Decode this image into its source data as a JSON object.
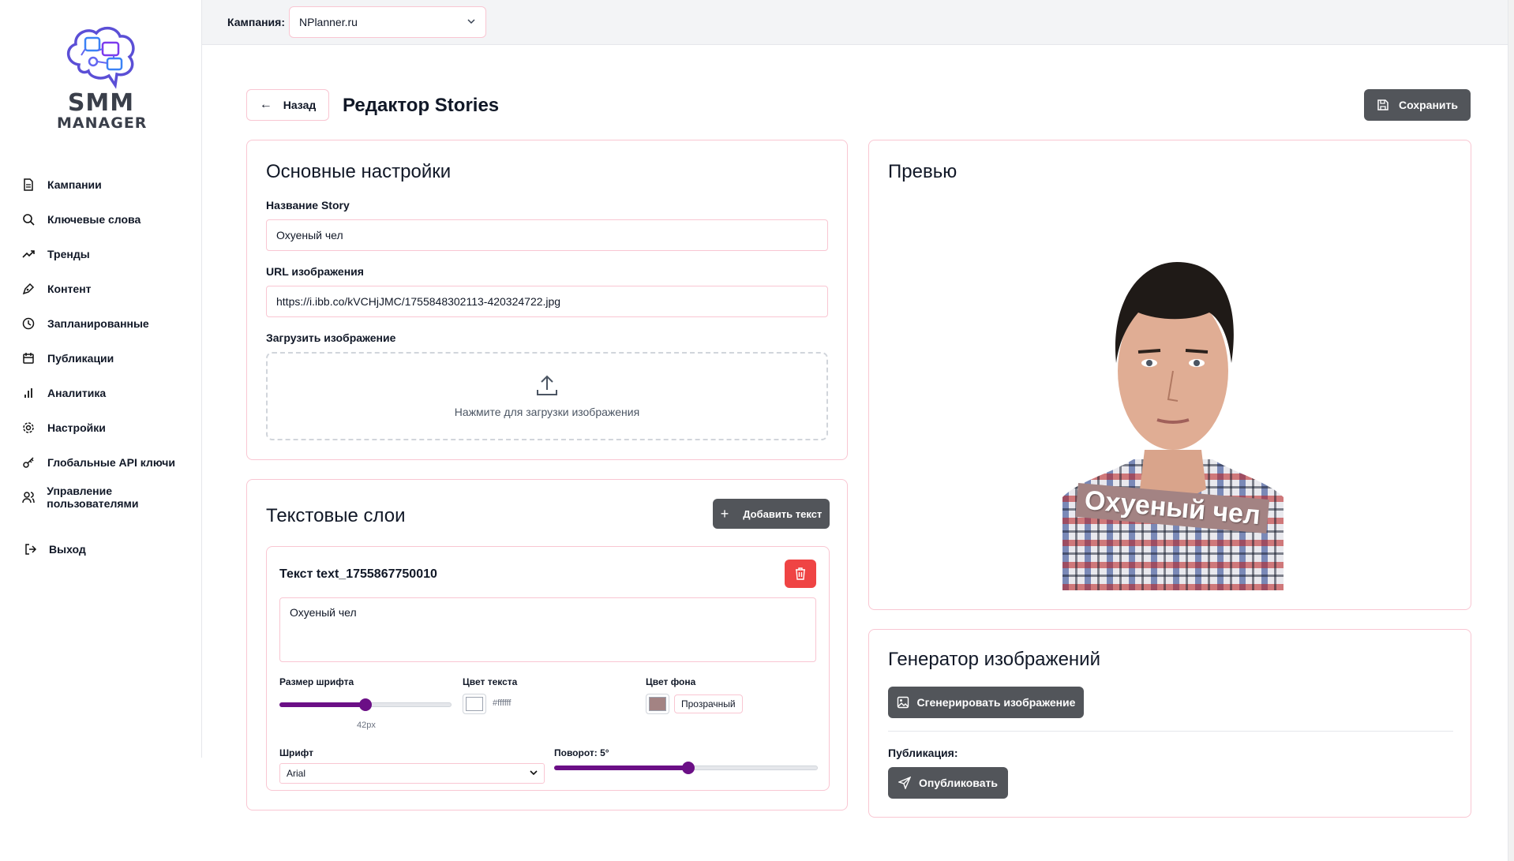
{
  "app": {
    "logo_line1": "SMM",
    "logo_line2": "MANAGER"
  },
  "sidebar": {
    "items": [
      {
        "label": "Кампании",
        "icon": "document-icon"
      },
      {
        "label": "Ключевые слова",
        "icon": "search-icon"
      },
      {
        "label": "Тренды",
        "icon": "trending-up-icon"
      },
      {
        "label": "Контент",
        "icon": "pen-tool-icon"
      },
      {
        "label": "Запланированные",
        "icon": "clock-icon"
      },
      {
        "label": "Публикации",
        "icon": "calendar-icon"
      },
      {
        "label": "Аналитика",
        "icon": "bar-chart-icon"
      },
      {
        "label": "Настройки",
        "icon": "gear-icon"
      },
      {
        "label": "Глобальные API ключи",
        "icon": "key-icon"
      },
      {
        "label": "Управление пользователями",
        "icon": "users-icon"
      }
    ],
    "logout_label": "Выход"
  },
  "topbar": {
    "campaign_label": "Кампания:",
    "campaign_value": "NPlanner.ru"
  },
  "header": {
    "back_label": "Назад",
    "title": "Редактор Stories",
    "save_label": "Сохранить"
  },
  "basic_settings": {
    "title": "Основные настройки",
    "story_name_label": "Название Story",
    "story_name_value": "Охуеный чел",
    "url_label": "URL изображения",
    "url_value": "https://i.ibb.co/kVCHjJMC/1755848302113-420324722.jpg",
    "upload_label": "Загрузить изображение",
    "upload_hint": "Нажмите для загрузки изображения"
  },
  "text_layers": {
    "title": "Текстовые слои",
    "add_label": "Добавить текст",
    "layers": [
      {
        "title": "Текст text_1755867750010",
        "text": "Охуеный чел",
        "font_size_label": "Размер шрифта",
        "font_size_value": "42px",
        "font_size_fraction": 0.5,
        "text_color_label": "Цвет текста",
        "text_color_value": "#ffffff",
        "bg_color_label": "Цвет фона",
        "bg_color_value": "#a38383",
        "transparent_label": "Прозрачный",
        "font_label": "Шрифт",
        "font_value": "Arial",
        "rotation_label": "Поворот: 5°",
        "rotation_fraction": 0.51
      }
    ]
  },
  "preview": {
    "title": "Превью",
    "overlay_text": "Охуеный чел"
  },
  "generator": {
    "title": "Генератор изображений",
    "generate_label": "Сгенерировать изображение",
    "publish_section_label": "Публикация:",
    "publish_label": "Опубликовать"
  },
  "colors": {
    "accent_dark": "#52555a",
    "slider_purple": "#6b0f86",
    "border_pink": "#f9c6d2",
    "danger": "#ef4444"
  }
}
